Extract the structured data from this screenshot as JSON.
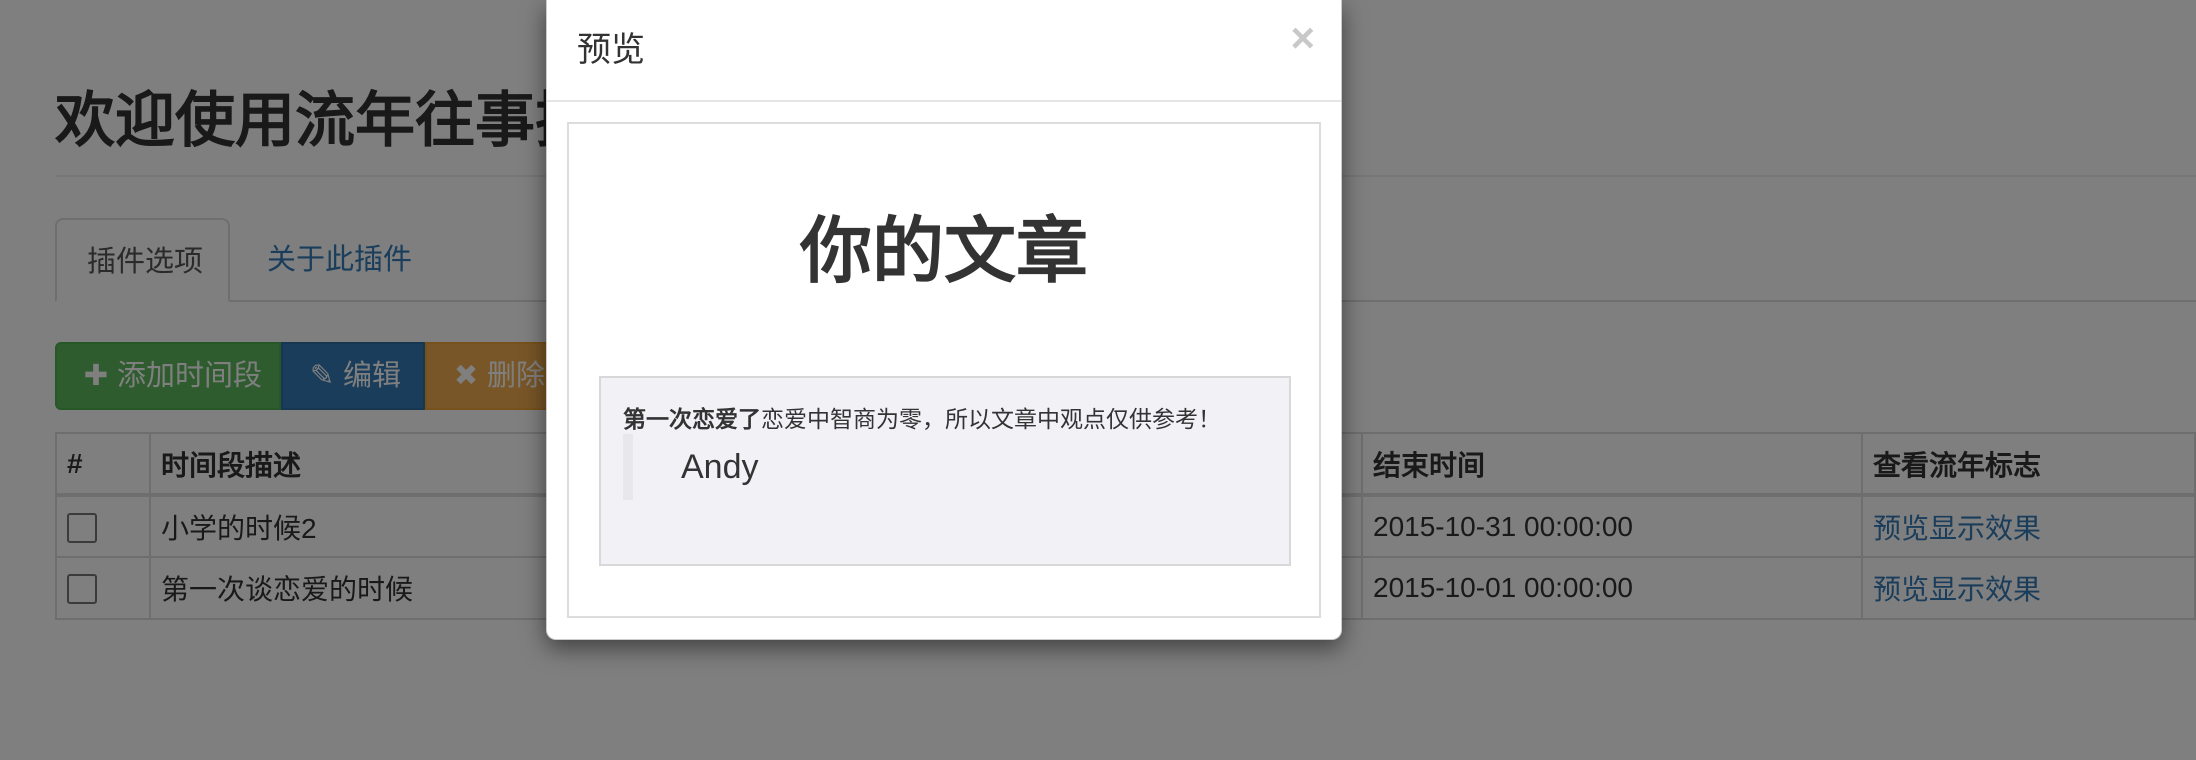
{
  "page": {
    "title": "欢迎使用流年往事插件"
  },
  "tabs": [
    {
      "label": "插件选项",
      "active": true
    },
    {
      "label": "关于此插件",
      "active": false
    }
  ],
  "toolbar": {
    "add_label": "添加时间段",
    "edit_label": "编辑",
    "delete_label": "删除时间段",
    "add_icon": "plus-icon",
    "edit_icon": "edit-icon",
    "delete_icon": "times-icon"
  },
  "table": {
    "headers": [
      "#",
      "时间段描述",
      "结束时间",
      "查看流年标志"
    ],
    "rows": [
      {
        "description": "小学的时候2",
        "end_time": "2015-10-31 00:00:00",
        "action": "预览显示效果"
      },
      {
        "description": "第一次谈恋爱的时候",
        "end_time": "2015-10-01 00:00:00",
        "action": "预览显示效果"
      }
    ]
  },
  "modal": {
    "title": "预览",
    "close_symbol": "×",
    "article_title": "你的文章",
    "quote_bold": "第一次恋爱了",
    "quote_rest": "恋爱中智商为零，所以文章中观点仅供参考！",
    "quote_author": "Andy"
  },
  "colors": {
    "success": "#5cb85c",
    "primary": "#337ab7",
    "warning": "#f0ad4e",
    "link": "#337ab7",
    "quote_bg": "#f2f1f6"
  }
}
